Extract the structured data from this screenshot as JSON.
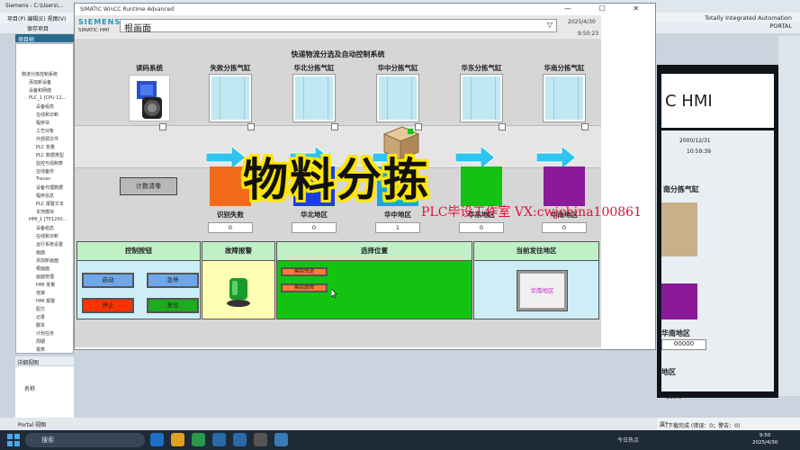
{
  "tia": {
    "title": "Siemens  -  C:\\Users\\...",
    "menu": "项目(P)  编辑(E)  视图(V)",
    "toolbar": "保存项目",
    "brand_line1": "Totally Integrated Automation",
    "brand_line2": "PORTAL",
    "project_tree_label": "项目树",
    "devices_label": "设备",
    "tree_items": [
      "物流分拣控制系统",
      "添加新设备",
      "设备和网络",
      "PLC_1 [CPU 12...",
      "设备组态",
      "在线和诊断",
      "程序块",
      "工艺对象",
      "外部源文件",
      "PLC 变量",
      "PLC 数据类型",
      "监控与强制表",
      "在线备份",
      "Traces",
      "设备代理数据",
      "程序信息",
      "PLC 报警文本",
      "本地模块",
      "HMI_1 [TP1200...",
      "设备组态",
      "在线和诊断",
      "运行系统设置",
      "画面",
      "添加新画面",
      "根画面",
      "画面管理",
      "HMI 变量",
      "连接",
      "HMI 报警",
      "配方",
      "记录",
      "脚本",
      "计划任务",
      "周期",
      "报表"
    ],
    "details_label": "详细视图",
    "details_col": "名称",
    "portal_view": "Portal 视图",
    "right_hmi_text": "C HMI",
    "right_date": "2000/12/31",
    "right_time": "10:59:39",
    "right_label1": "南分拣气缸",
    "right_label2": "华南地区",
    "right_value": "00000",
    "right_label3": "地区",
    "zoom": "100%",
    "props_tabs": "属性  信息  诊断",
    "status_text": "下载完成 (错误：0；警告：0)"
  },
  "window": {
    "title": "SIMATIC WinCC Runtime Advanced",
    "controls": "—  ☐  ✕"
  },
  "hmi": {
    "brand": "SIEMENS",
    "product": "SIMATIC HMI",
    "screen_name": "根画面",
    "date": "2025/4/30",
    "time": "9:50:23",
    "system_title": "快递物流分选及自动控制系统",
    "reader_label": "读码系统",
    "cylinders": [
      {
        "label": "失败分拣气缸",
        "bin_color": "#f26b1d",
        "count_label": "识别失败",
        "count": "0"
      },
      {
        "label": "华北分拣气缸",
        "bin_color": "#1a3ee6",
        "count_label": "华北地区",
        "count": "0"
      },
      {
        "label": "华中分拣气缸",
        "bin_color": "#1aa7d8",
        "count_label": "华中地区",
        "count": "1"
      },
      {
        "label": "华东分拣气缸",
        "bin_color": "#12c312",
        "count_label": "华东地区",
        "count": "0"
      },
      {
        "label": "华南分拣气缸",
        "bin_color": "#8a1a9a",
        "count_label": "华南地区",
        "count": "0"
      }
    ],
    "reset_button": "计数清零",
    "sections": {
      "control": "控制按钮",
      "alarm": "故障报警",
      "position": "选择位置",
      "area": "当前发往地区"
    },
    "buttons": {
      "start": "启动",
      "estop": "急停",
      "stop": "停止",
      "reset": "复位"
    },
    "position_options": [
      "模拟快递",
      "模拟故障"
    ],
    "current_area": "华南地区"
  },
  "overlay": {
    "title": "物料分拣",
    "watermark": "PLC毕设工作室 VX:cwjchina100861"
  },
  "taskbar": {
    "search": "搜索",
    "weather": "今日热点",
    "time": "9:50",
    "date": "2025/4/30"
  },
  "colors": {
    "siemens_teal": "#1a9bc6",
    "conveyor_arrow": "#2ec4f0",
    "start_button": "#6fa6e8",
    "stop_button": "#ff3300",
    "reset_button": "#1faa1f",
    "alarm_light": "#1a9a2a",
    "area_text": "#d020d0"
  }
}
